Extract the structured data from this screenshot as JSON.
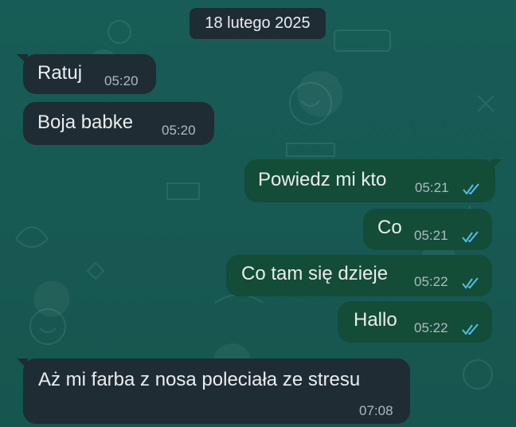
{
  "date_divider": "18 lutego 2025",
  "messages": [
    {
      "direction": "incoming",
      "text": "Ratuj",
      "time": "05:20"
    },
    {
      "direction": "incoming",
      "text": "Boja babke",
      "time": "05:20"
    },
    {
      "direction": "outgoing",
      "text": "Powiedz mi kto",
      "time": "05:21",
      "status": "read"
    },
    {
      "direction": "outgoing",
      "text": "Co",
      "time": "05:21",
      "status": "read"
    },
    {
      "direction": "outgoing",
      "text": "Co tam się dzieje",
      "time": "05:22",
      "status": "read"
    },
    {
      "direction": "outgoing",
      "text": "Hallo",
      "time": "05:22",
      "status": "read"
    },
    {
      "direction": "incoming",
      "text": "Aż mi farba z nosa poleciała ze stresu",
      "time": "07:08"
    }
  ],
  "colors": {
    "background": "#175a55",
    "incoming_bubble": "#1f2c33",
    "outgoing_bubble": "#134d37",
    "read_ticks": "#53bdeb",
    "text": "#e9edef",
    "timestamp": "#aebac1"
  },
  "icons": {
    "read_receipt": "double-check-icon"
  }
}
